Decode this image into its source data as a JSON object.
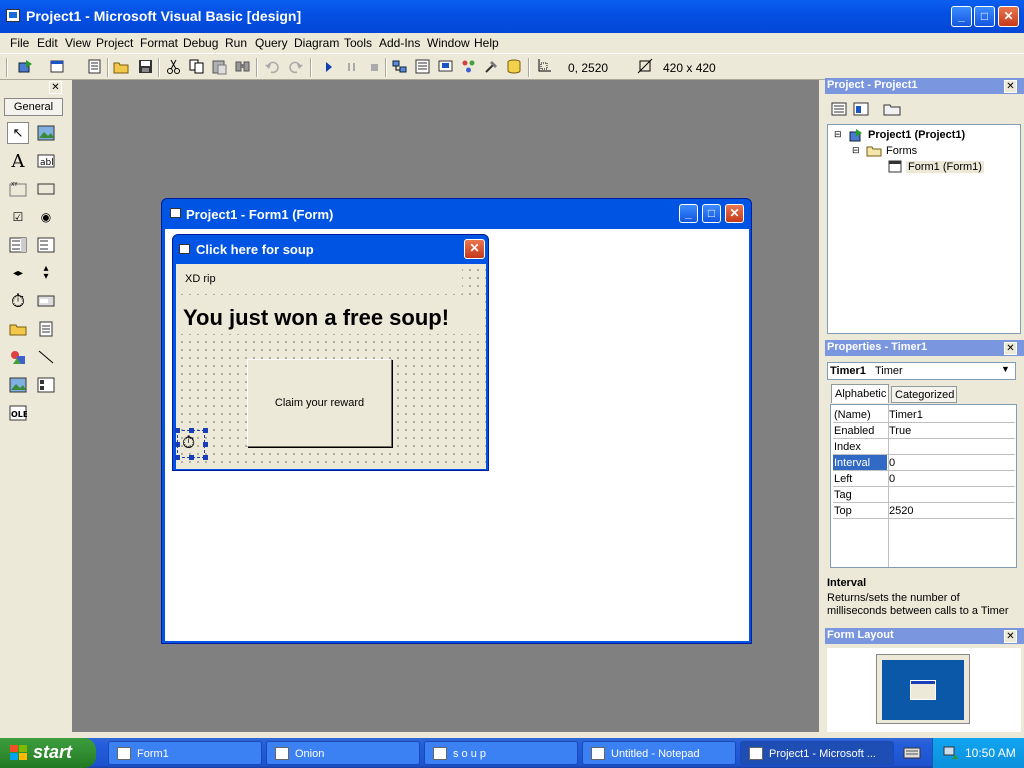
{
  "window": {
    "title": "Project1 - Microsoft Visual Basic [design]"
  },
  "menu": [
    "File",
    "Edit",
    "View",
    "Project",
    "Format",
    "Debug",
    "Run",
    "Query",
    "Diagram",
    "Tools",
    "Add-Ins",
    "Window",
    "Help"
  ],
  "toolbar": {
    "position": "0, 2520",
    "size": "420 x 420"
  },
  "toolbox": {
    "tab": "General"
  },
  "form_window": {
    "title": "Project1 - Form1 (Form)"
  },
  "inner_form": {
    "title": "Click here for soup",
    "label_small": "XD rip",
    "label_big": "You just won a free soup!",
    "button": "Claim your reward"
  },
  "project_pane": {
    "title": "Project - Project1",
    "root": "Project1 (Project1)",
    "folder": "Forms",
    "item": "Form1 (Form1)"
  },
  "properties_pane": {
    "title": "Properties - Timer1",
    "object_name": "Timer1",
    "object_type": "Timer",
    "tab_alpha": "Alphabetic",
    "tab_cat": "Categorized",
    "rows": [
      {
        "name": "(Name)",
        "value": "Timer1"
      },
      {
        "name": "Enabled",
        "value": "True"
      },
      {
        "name": "Index",
        "value": ""
      },
      {
        "name": "Interval",
        "value": "0"
      },
      {
        "name": "Left",
        "value": "0"
      },
      {
        "name": "Tag",
        "value": ""
      },
      {
        "name": "Top",
        "value": "2520"
      }
    ],
    "desc_title": "Interval",
    "desc_text": "Returns/sets the number of milliseconds between calls to a Timer"
  },
  "form_layout": {
    "title": "Form Layout"
  },
  "taskbar": {
    "start": "start",
    "tasks": [
      "Form1",
      "Onion",
      "s o u p",
      "Untitled - Notepad",
      "Project1 - Microsoft ..."
    ],
    "clock": "10:50 AM"
  },
  "colors": {
    "xp_blue": "#0054e3",
    "selected_row": "#316ac5",
    "mdi_gray": "#808080"
  }
}
